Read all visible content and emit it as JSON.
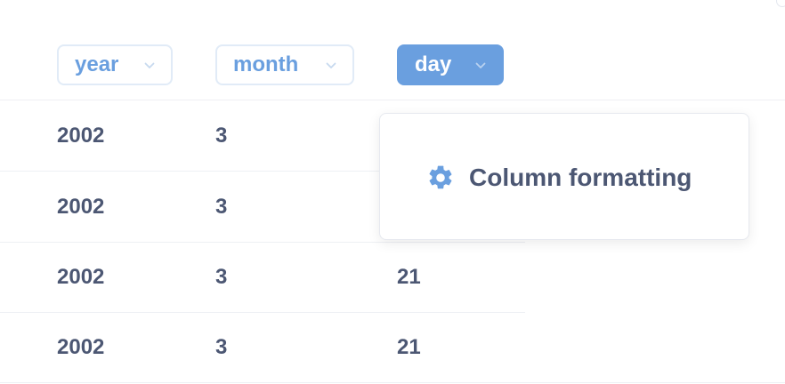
{
  "colors": {
    "accent": "#6a9fdf",
    "text": "#4c5773",
    "pill_border": "#e1ebf7",
    "divider": "#eef0f4"
  },
  "columns": [
    {
      "label": "year",
      "active": false,
      "icon": "chevron-down-icon"
    },
    {
      "label": "month",
      "active": false,
      "icon": "chevron-down-icon"
    },
    {
      "label": "day",
      "active": true,
      "icon": "chevron-down-icon"
    }
  ],
  "rows": [
    {
      "year": "2002",
      "month": "3",
      "day": ""
    },
    {
      "year": "2002",
      "month": "3",
      "day": ""
    },
    {
      "year": "2002",
      "month": "3",
      "day": "21"
    },
    {
      "year": "2002",
      "month": "3",
      "day": "21"
    }
  ],
  "popover": {
    "item_label": "Column formatting",
    "item_icon": "gear-icon"
  }
}
